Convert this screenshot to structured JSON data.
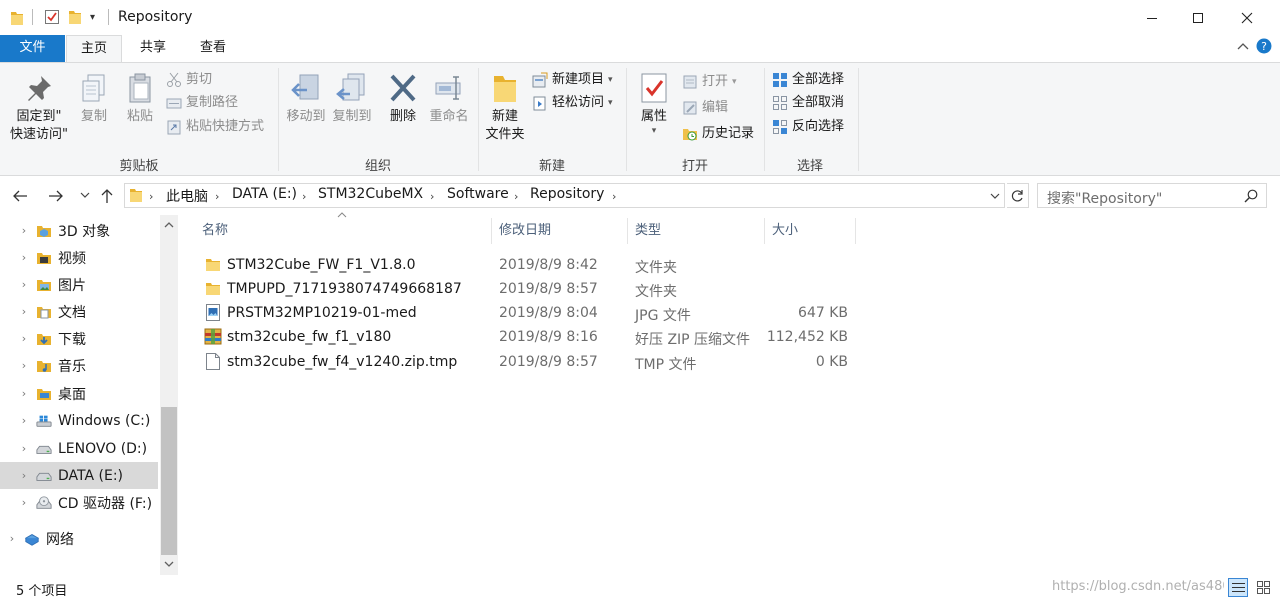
{
  "window": {
    "title": "Repository",
    "controls": {
      "minimize": "—",
      "maximize": "☐",
      "close": "✕"
    }
  },
  "tabs": [
    {
      "label": "文件"
    },
    {
      "label": "主页"
    },
    {
      "label": "共享"
    },
    {
      "label": "查看"
    }
  ],
  "ribbon": {
    "clipboard": {
      "group_label": "剪贴板",
      "pin_line1": "固定到\"",
      "pin_line2": "快速访问\"",
      "copy": "复制",
      "paste": "粘贴",
      "cut": "剪切",
      "copy_path": "复制路径",
      "paste_shortcut": "粘贴快捷方式"
    },
    "organize": {
      "group_label": "组织",
      "move_to": "移动到",
      "copy_to": "复制到",
      "delete": "删除",
      "rename": "重命名"
    },
    "new": {
      "group_label": "新建",
      "new_folder_line1": "新建",
      "new_folder_line2": "文件夹",
      "new_item": "新建项目",
      "easy_access": "轻松访问"
    },
    "open": {
      "group_label": "打开",
      "properties": "属性",
      "open": "打开",
      "edit": "编辑",
      "history": "历史记录"
    },
    "select": {
      "group_label": "选择",
      "select_all": "全部选择",
      "select_none": "全部取消",
      "invert": "反向选择"
    }
  },
  "address": {
    "crumbs": [
      "此电脑",
      "DATA (E:)",
      "STM32CubeMX",
      "Software",
      "Repository"
    ],
    "search_placeholder": "搜索\"Repository\""
  },
  "nav": {
    "items": [
      {
        "label": "3D 对象",
        "icon": "3d-objects-icon"
      },
      {
        "label": "视频",
        "icon": "video-icon"
      },
      {
        "label": "图片",
        "icon": "pictures-icon"
      },
      {
        "label": "文档",
        "icon": "documents-icon"
      },
      {
        "label": "下载",
        "icon": "downloads-icon"
      },
      {
        "label": "音乐",
        "icon": "music-icon"
      },
      {
        "label": "桌面",
        "icon": "desktop-icon"
      },
      {
        "label": "Windows (C:)",
        "icon": "windows-drive-icon"
      },
      {
        "label": "LENOVO (D:)",
        "icon": "drive-icon"
      },
      {
        "label": "DATA (E:)",
        "icon": "drive-icon",
        "selected": true
      },
      {
        "label": "CD 驱动器 (F:)",
        "icon": "cd-drive-icon"
      },
      {
        "label": "网络",
        "icon": "network-icon"
      }
    ]
  },
  "files": {
    "columns": [
      "名称",
      "修改日期",
      "类型",
      "大小"
    ],
    "rows": [
      {
        "name": "STM32Cube_FW_F1_V1.8.0",
        "date": "2019/8/9 8:42",
        "type": "文件夹",
        "size": "",
        "icon": "folder-icon"
      },
      {
        "name": "TMPUPD_7171938074749668187",
        "date": "2019/8/9 8:57",
        "type": "文件夹",
        "size": "",
        "icon": "folder-icon"
      },
      {
        "name": "PRSTM32MP10219-01-med",
        "date": "2019/8/9 8:04",
        "type": "JPG 文件",
        "size": "647 KB",
        "icon": "jpg-file-icon"
      },
      {
        "name": "stm32cube_fw_f1_v180",
        "date": "2019/8/9 8:16",
        "type": "好压 ZIP 压缩文件",
        "size": "112,452 KB",
        "icon": "zip-archive-icon"
      },
      {
        "name": "stm32cube_fw_f4_v1240.zip.tmp",
        "date": "2019/8/9 8:57",
        "type": "TMP 文件",
        "size": "0 KB",
        "icon": "blank-file-icon"
      }
    ]
  },
  "status": {
    "count": "5 个项目",
    "watermark": "https://blog.csdn.net/as480"
  }
}
